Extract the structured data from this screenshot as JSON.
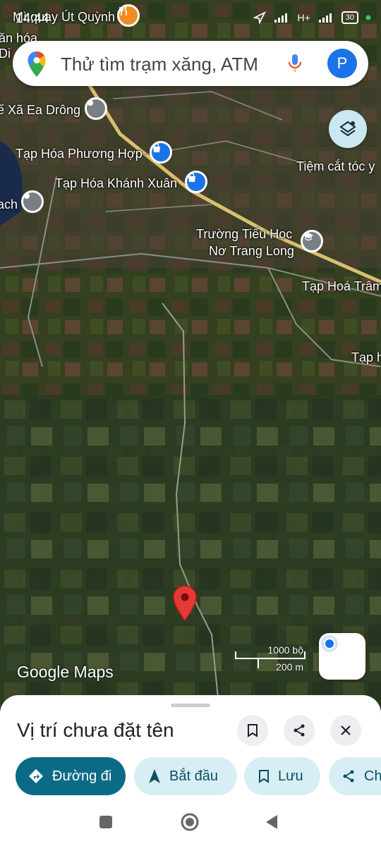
{
  "status_bar": {
    "time": "14:44",
    "network": "H+",
    "battery": "30"
  },
  "search": {
    "placeholder": "Thử tìm trạm xăng, ATM",
    "avatar_letter": "P"
  },
  "map": {
    "labels": {
      "restaurant": "Mì quay Út Quỳnh",
      "van_hoa": "ăn hóa",
      "di": "Di",
      "xa_ea_drong": "ế Xã Ea Drông",
      "tap_hoa_phuong_hop": "Tạp Hóa Phương Hợp",
      "tap_hoa_khanh_xuan": "Tạp Hóa Khánh Xuân",
      "ach": "ach",
      "tiem_cat_toc": "Tiệm cắt tóc y",
      "school_line1": "Trường Tiểu Học",
      "school_line2": "Nơ Trang Long",
      "tap_hoa_tram": "Tạp Hoá Trâm",
      "tap_h": "Tạp h"
    },
    "scale": {
      "imperial": "1000 bộ",
      "metric": "200 m"
    },
    "attribution": "Google Maps",
    "colors": {
      "pin": "#e53935",
      "poi_blue": "#1a73e8",
      "poi_gray": "#7a7f85",
      "poi_orange": "#f28b21"
    }
  },
  "place_sheet": {
    "title": "Vị trí chưa đặt tên",
    "actions": {
      "directions": "Đường đi",
      "start": "Bắt đầu",
      "save": "Lưu",
      "share": "Ch"
    }
  }
}
